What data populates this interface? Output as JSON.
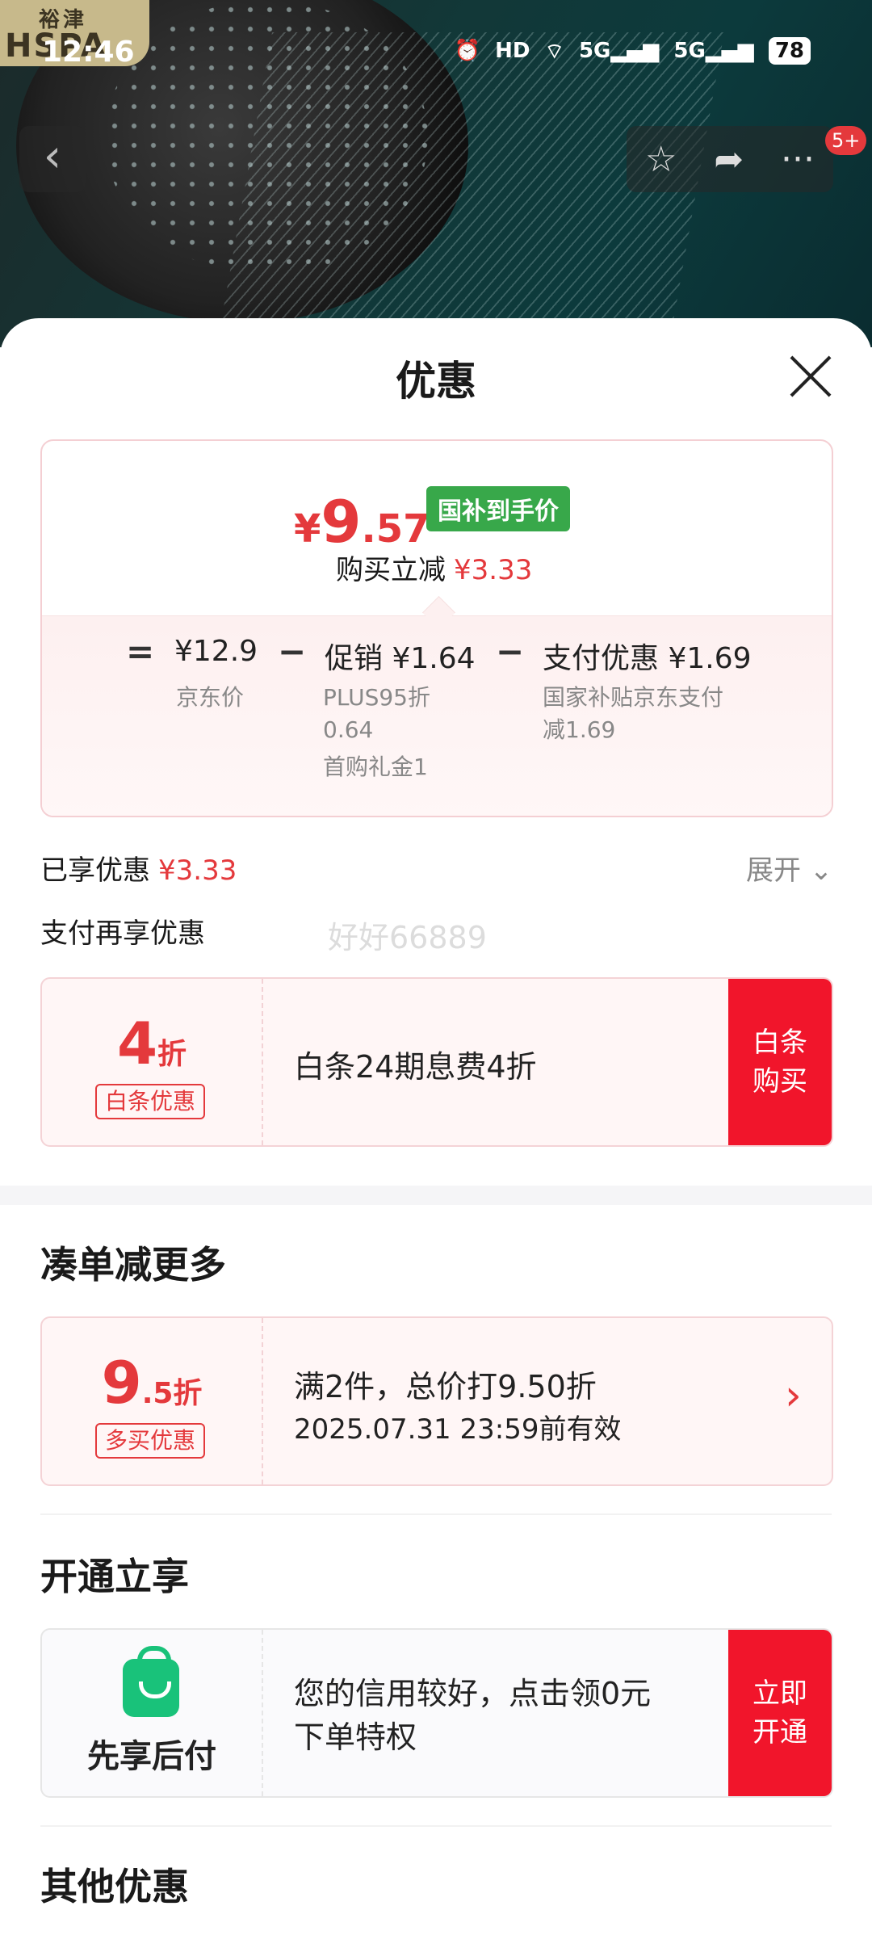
{
  "status": {
    "time": "12:46",
    "hd": "HD",
    "net1": "5G",
    "net2": "5G",
    "battery": "78"
  },
  "brand": {
    "line1": "裕津",
    "line2": "HSPA"
  },
  "nav": {
    "badge": "5+"
  },
  "sheet": {
    "title": "优惠",
    "price": {
      "currency": "¥",
      "integer": "9",
      "decimal": ".57",
      "tag": "国补到手价",
      "reduce_label": "购买立减",
      "reduce_value": "¥3.33"
    },
    "breakdown": {
      "eq": "=",
      "jd_value": "¥12.9",
      "jd_label": "京东价",
      "minus1": "−",
      "promo_value": "促销 ¥1.64",
      "promo_line1": "PLUS95折",
      "promo_line2": "0.64",
      "promo_line3": "首购礼金1",
      "minus2": "−",
      "pay_value": "支付优惠 ¥1.69",
      "pay_line1": "国家补贴京东支付",
      "pay_line2": "减1.69"
    },
    "enjoyed_label": "已享优惠",
    "enjoyed_value": "¥3.33",
    "expand": "展开 ⌄",
    "pay_more": "支付再享优惠",
    "watermark": "好好66889",
    "baitiao": {
      "disc_big": "4",
      "disc_small": "折",
      "label": "白条优惠",
      "text": "白条24期息费4折",
      "cta1": "白条",
      "cta2": "购买"
    },
    "section_more": "凑单减更多",
    "more_coupon": {
      "disc_big": "9",
      "disc_small": ".5折",
      "label": "多买优惠",
      "text1": "满2件，总价打9.50折",
      "text2": "2025.07.31 23:59前有效",
      "arrow": "›"
    },
    "section_open": "开通立享",
    "open_coupon": {
      "name": "先享后付",
      "text1": "您的信用较好，点击领0元",
      "text2": "下单特权",
      "cta1": "立即",
      "cta2": "开通"
    },
    "section_other": "其他优惠"
  }
}
